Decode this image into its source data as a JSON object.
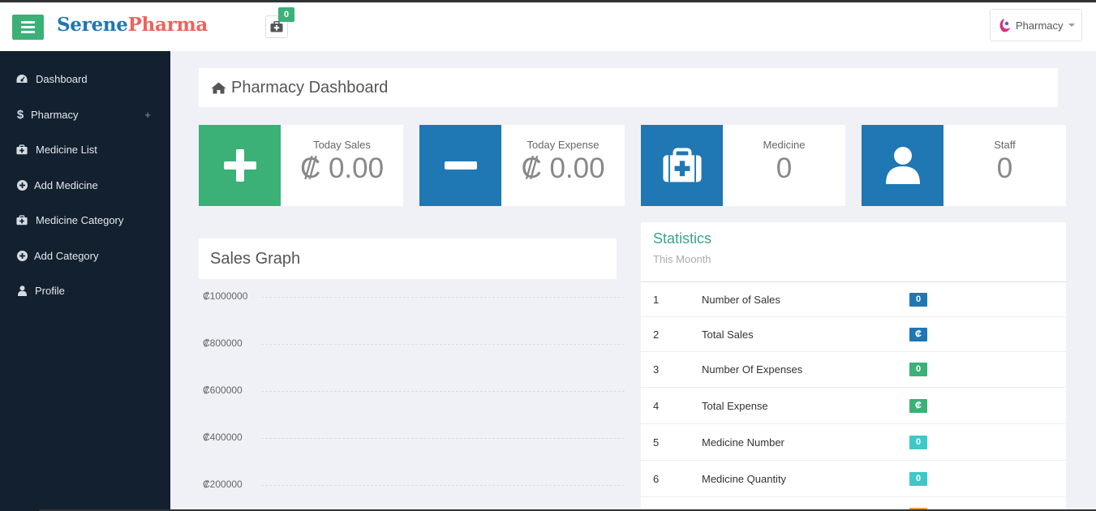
{
  "header": {
    "brand_part1": "Serene",
    "brand_part2": "Pharma",
    "cart_count": "0",
    "user_label": "Pharmacy"
  },
  "sidebar": {
    "items": [
      {
        "label": "Dashboard",
        "icon": "dashboard-icon"
      },
      {
        "label": "Pharmacy",
        "icon": "dollar-icon",
        "expand": "+"
      },
      {
        "label": "Medicine List",
        "icon": "medkit-icon"
      },
      {
        "label": "Add Medicine",
        "icon": "plus-circle-icon"
      },
      {
        "label": "Medicine Category",
        "icon": "medkit-icon"
      },
      {
        "label": "Add Category",
        "icon": "plus-circle-icon"
      },
      {
        "label": "Profile",
        "icon": "user-icon"
      }
    ]
  },
  "page": {
    "title": "Pharmacy Dashboard"
  },
  "cards": [
    {
      "label": "Today Sales",
      "value": "₡ 0.00",
      "color": "#3bb077",
      "icon": "plus-icon"
    },
    {
      "label": "Today Expense",
      "value": "₡ 0.00",
      "color": "#1f77b4",
      "icon": "minus-icon"
    },
    {
      "label": "Medicine",
      "value": "0",
      "color": "#1f77b4",
      "icon": "medkit-icon"
    },
    {
      "label": "Staff",
      "value": "0",
      "color": "#1f77b4",
      "icon": "user-icon"
    }
  ],
  "graph": {
    "title": "Sales Graph",
    "y_ticks": [
      "₡1000000",
      "₡800000",
      "₡600000",
      "₡400000",
      "₡200000"
    ]
  },
  "statistics": {
    "title": "Statistics",
    "subtitle": "This Moonth",
    "rows": [
      {
        "n": "1",
        "name": "Number of Sales",
        "badge": "0",
        "color": "#1f77b4"
      },
      {
        "n": "2",
        "name": "Total Sales",
        "badge": "₡",
        "color": "#1f77b4"
      },
      {
        "n": "3",
        "name": "Number Of Expenses",
        "badge": "0",
        "color": "#3bb077"
      },
      {
        "n": "4",
        "name": "Total Expense",
        "badge": "₡",
        "color": "#3bb077"
      },
      {
        "n": "5",
        "name": "Medicine Number",
        "badge": "0",
        "color": "#3ec8c8"
      },
      {
        "n": "6",
        "name": "Medicine Quantity",
        "badge": "0",
        "color": "#3ec8c8"
      }
    ]
  },
  "colors": {
    "accent_green": "#3bb077",
    "accent_blue": "#1f77b4",
    "sidebar_bg": "#132030",
    "brand_red": "#f0625d"
  }
}
